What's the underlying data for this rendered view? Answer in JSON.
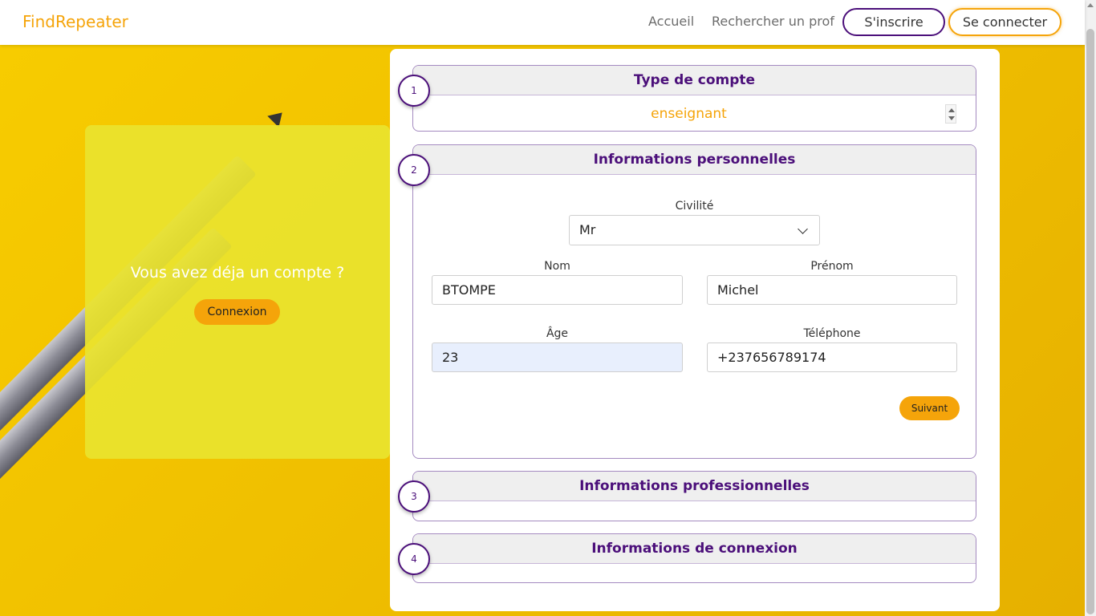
{
  "navbar": {
    "brand": "FindRepeater",
    "links": [
      "Accueil",
      "Rechercher un prof"
    ],
    "signup_label": "S'inscrire",
    "login_label": "Se connecter"
  },
  "left_card": {
    "title": "Vous avez déja un compte ?",
    "button_label": "Connexion"
  },
  "form": {
    "steps": [
      {
        "number": "1",
        "title": "Type de compte"
      },
      {
        "number": "2",
        "title": "Informations personnelles"
      },
      {
        "number": "3",
        "title": "Informations professionnelles"
      },
      {
        "number": "4",
        "title": "Informations de connexion"
      }
    ],
    "account_type": "enseignant",
    "civility": {
      "label": "Civilité",
      "value": "Mr"
    },
    "nom": {
      "label": "Nom",
      "value": "BTOMPE"
    },
    "prenom": {
      "label": "Prénom",
      "value": "Michel"
    },
    "age": {
      "label": "Âge",
      "value": "23"
    },
    "telephone": {
      "label": "Téléphone",
      "value": "+237656789174"
    },
    "next_label": "Suivant"
  },
  "colors": {
    "accent": "#f5a40a",
    "brand_purple": "#4b0f7a",
    "background": "#f1c40f"
  }
}
